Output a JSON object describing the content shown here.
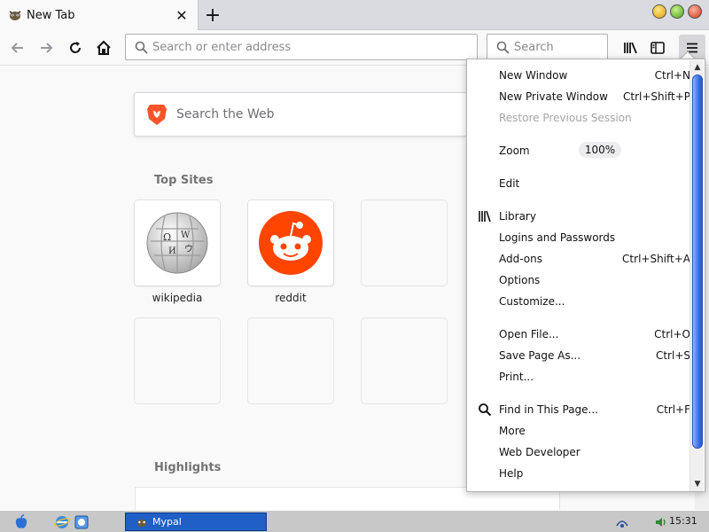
{
  "tabbar": {
    "tab_title": "New Tab",
    "new_tab_label": "+",
    "close_label": "✕"
  },
  "navbar": {
    "address_placeholder": "Search or enter address",
    "search_placeholder": "Search"
  },
  "newtab_page": {
    "web_search_placeholder": "Search the Web",
    "top_sites_heading": "Top Sites",
    "highlights_heading": "Highlights",
    "top_sites": [
      {
        "label": "wikipedia",
        "icon": "wikipedia-globe-icon"
      },
      {
        "label": "reddit",
        "icon": "reddit-alien-icon"
      },
      {
        "label": "",
        "icon": ""
      }
    ]
  },
  "app_menu": {
    "items": [
      {
        "label": "New Window",
        "shortcut": "Ctrl+N"
      },
      {
        "label": "New Private Window",
        "shortcut": "Ctrl+Shift+P"
      },
      {
        "label": "Restore Previous Session",
        "shortcut": "",
        "disabled": true
      },
      {
        "label": "Zoom",
        "value": "100%"
      },
      {
        "label": "Edit"
      },
      {
        "label": "Library",
        "icon": "library-icon"
      },
      {
        "label": "Logins and Passwords"
      },
      {
        "label": "Add-ons",
        "shortcut": "Ctrl+Shift+A"
      },
      {
        "label": "Options"
      },
      {
        "label": "Customize..."
      },
      {
        "label": "Open File...",
        "shortcut": "Ctrl+O"
      },
      {
        "label": "Save Page As...",
        "shortcut": "Ctrl+S"
      },
      {
        "label": "Print..."
      },
      {
        "label": "Find in This Page...",
        "shortcut": "Ctrl+F",
        "icon": "magnifier-icon"
      },
      {
        "label": "More"
      },
      {
        "label": "Web Developer"
      },
      {
        "label": "Help"
      }
    ]
  },
  "taskbar": {
    "task_label": "Mypal",
    "clock": "15:31"
  },
  "colors": {
    "accent_blue": "#1f5fc6",
    "reddit_orange": "#ff4500",
    "brave_orange": "#fb542b"
  }
}
